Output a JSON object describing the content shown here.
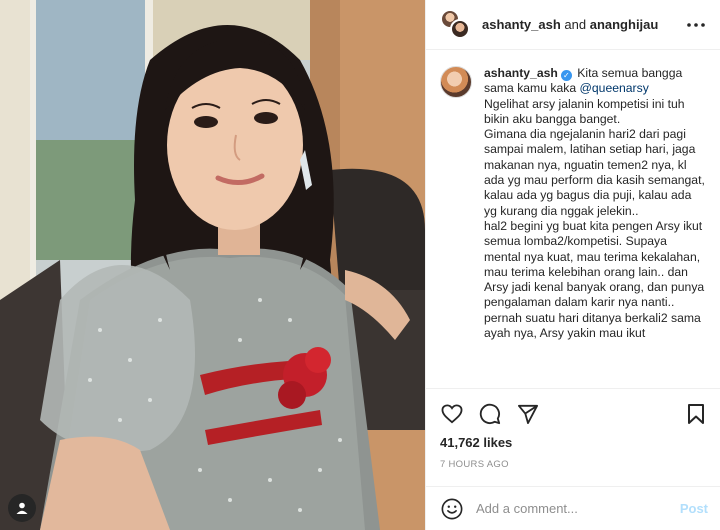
{
  "header": {
    "user1": "ashanty_ash",
    "and": "and",
    "user2": "ananghijau",
    "more_icon": "more-horizontal-icon"
  },
  "caption": {
    "username": "ashanty_ash",
    "verified_icon": "verified-badge-icon",
    "text_before_mention": "Kita semua bangga sama kamu kaka ",
    "mention": "@queenarsy",
    "text_after_mention": "\nNgelihat arsy jalanin kompetisi ini tuh bikin aku bangga banget.\nGimana dia ngejalanin hari2 dari pagi sampai malem, latihan setiap hari, jaga makanan nya, nguatin temen2 nya, kl ada yg mau perform dia kasih semangat, kalau ada yg bagus dia puji, kalau ada yg kurang dia nggak jelekin..\nhal2 begini yg buat kita pengen Arsy ikut semua lomba2/kompetisi. Supaya mental nya kuat, mau terima kekalahan, mau terima kelebihan orang lain.. dan Arsy jadi kenal banyak orang, dan punya pengalaman dalam karir nya nanti..\npernah suatu hari ditanya berkali2 sama ayah nya, Arsy yakin mau ikut"
  },
  "actions": {
    "like_icon": "heart-icon",
    "comment_icon": "comment-icon",
    "share_icon": "send-icon",
    "save_icon": "bookmark-icon",
    "likes": "41,762 likes",
    "time": "7 HOURS AGO"
  },
  "comment": {
    "emoji_icon": "emoji-smile-icon",
    "placeholder": "Add a comment...",
    "post_label": "Post"
  },
  "photo": {
    "user_tag_icon": "user-tag-icon"
  }
}
